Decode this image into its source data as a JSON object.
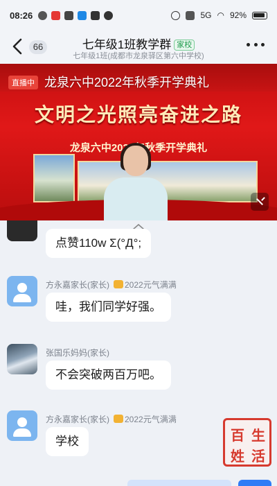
{
  "status_bar": {
    "time": "08:26",
    "network": "5G",
    "battery": "92%"
  },
  "header": {
    "back_badge": "66",
    "title": "七年级1班教学群",
    "title_tag": "家校",
    "subtitle": "七年级1班(成都市龙泉驿区第六中学校)"
  },
  "live": {
    "badge": "直播中",
    "title": "龙泉六中2022年秋季开学典礼",
    "headline": "文明之光照亮奋进之路",
    "subheading": "龙泉六中2022年秋季开学典礼"
  },
  "messages": [
    {
      "text": "点赞110w        Σ(°Д°;"
    },
    {
      "name": "方永嘉家长(家长)",
      "title": "2022元气满满",
      "text": "哇，我们同学好强。"
    },
    {
      "name": "张国乐妈妈(家长)",
      "text": "不会突破两百万吧。"
    },
    {
      "name": "方永嘉家长(家长)",
      "title": "2022元气满满",
      "text": "学校"
    }
  ],
  "watermark": {
    "chars": [
      "百",
      "生",
      "姓",
      "活"
    ]
  },
  "colors": {
    "accent": "#2f7cf6",
    "live_red": "#e01818",
    "school_tag": "#1b9a4a"
  }
}
